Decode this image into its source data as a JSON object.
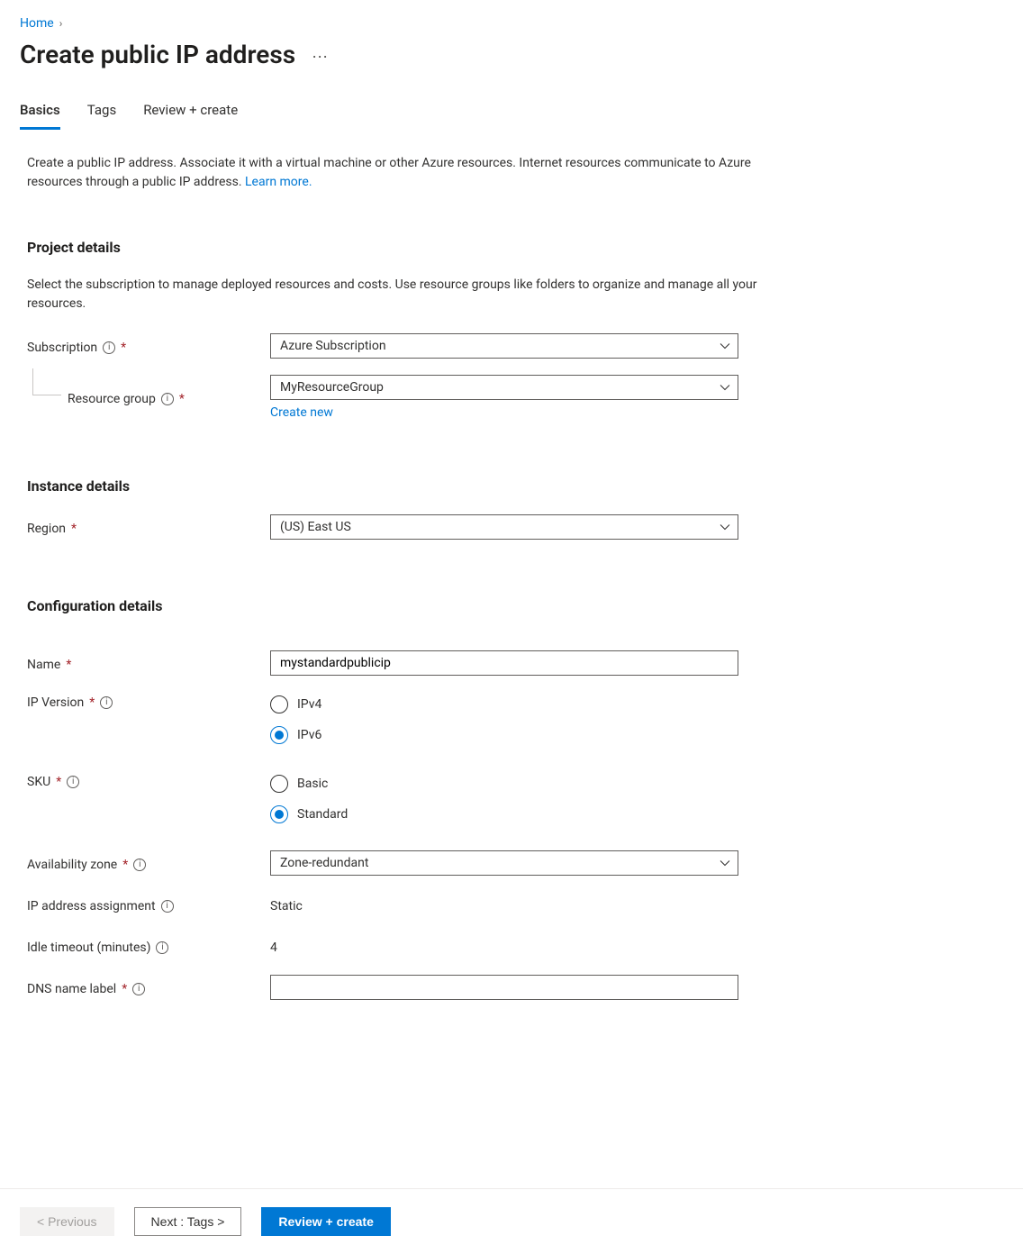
{
  "breadcrumb": {
    "home": "Home"
  },
  "page_title": "Create public IP address",
  "tabs": {
    "basics": "Basics",
    "tags": "Tags",
    "review": "Review + create"
  },
  "intro": {
    "text_a": "Create a public IP address. Associate it with a virtual machine or other Azure resources. Internet resources communicate to Azure resources through a public IP address. ",
    "learn_more": "Learn more."
  },
  "sections": {
    "project": {
      "heading": "Project details",
      "desc": "Select the subscription to manage deployed resources and costs. Use resource groups like folders to organize and manage all your resources.",
      "subscription_label": "Subscription",
      "subscription_value": "Azure Subscription",
      "rg_label": "Resource group",
      "rg_value": "MyResourceGroup",
      "create_new": "Create new"
    },
    "instance": {
      "heading": "Instance details",
      "region_label": "Region",
      "region_value": "(US) East US"
    },
    "config": {
      "heading": "Configuration details",
      "name_label": "Name",
      "name_value": "mystandardpublicip",
      "ipv_label": "IP Version",
      "ipv4": "IPv4",
      "ipv6": "IPv6",
      "sku_label": "SKU",
      "sku_basic": "Basic",
      "sku_standard": "Standard",
      "az_label": "Availability zone",
      "az_value": "Zone-redundant",
      "assign_label": "IP address assignment",
      "assign_value": "Static",
      "idle_label": "Idle timeout (minutes)",
      "idle_value": "4",
      "dns_label": "DNS name label"
    }
  },
  "footer": {
    "prev": "< Previous",
    "next": "Next : Tags >",
    "review": "Review + create"
  }
}
